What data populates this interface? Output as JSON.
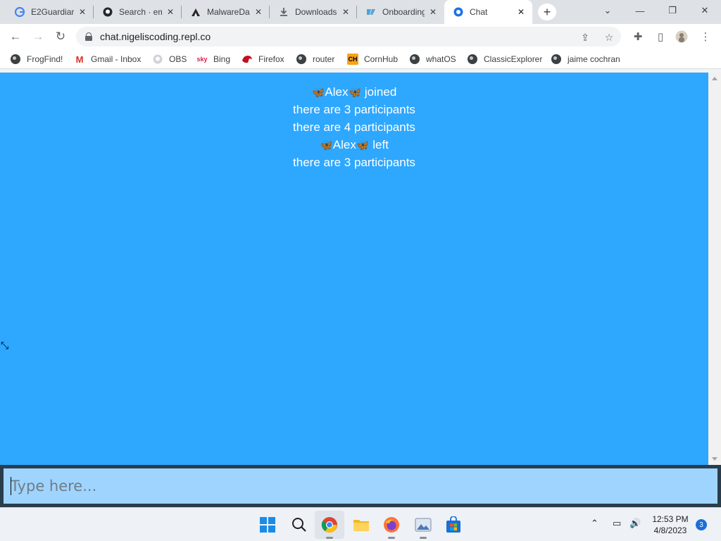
{
  "browser": {
    "tabs": [
      {
        "title": "E2Guardian",
        "icon": "google-icon"
      },
      {
        "title": "Search · em",
        "icon": "github-icon"
      },
      {
        "title": "MalwareDa",
        "icon": "malwaredatabase-icon"
      },
      {
        "title": "Downloads",
        "icon": "download-icon"
      },
      {
        "title": "Onboarding",
        "icon": "replit-icon"
      },
      {
        "title": "Chat",
        "icon": "chat-icon",
        "active": true
      }
    ],
    "url": "chat.nigeliscoding.repl.co",
    "bookmarks": [
      {
        "label": "FrogFind!",
        "icon": "globe-icon"
      },
      {
        "label": "Gmail - Inbox",
        "icon": "gmail-icon"
      },
      {
        "label": "OBS",
        "icon": "github-icon"
      },
      {
        "label": "Bing",
        "icon": "sky-icon"
      },
      {
        "label": "Firefox",
        "icon": "firefox-icon"
      },
      {
        "label": "router",
        "icon": "globe-icon"
      },
      {
        "label": "CornHub",
        "icon": "cornhub-icon"
      },
      {
        "label": "whatOS",
        "icon": "globe-icon"
      },
      {
        "label": "ClassicExplorer",
        "icon": "globe-icon"
      },
      {
        "label": "jaime cochran",
        "icon": "globe-icon"
      }
    ]
  },
  "chat": {
    "background_color": "#2ea7ff",
    "messages": [
      {
        "name": "Alex",
        "rest": "joined",
        "has_emoji": true
      },
      {
        "text": "there are 3 participants"
      },
      {
        "text": "there are 4 participants"
      },
      {
        "name": "Alex",
        "rest": "left",
        "has_emoji": true
      },
      {
        "text": "there are 3 participants"
      }
    ],
    "input": {
      "placeholder": "Type here...",
      "value": ""
    }
  },
  "taskbar": {
    "time": "12:53 PM",
    "date": "4/8/2023",
    "notification_count": "3"
  }
}
